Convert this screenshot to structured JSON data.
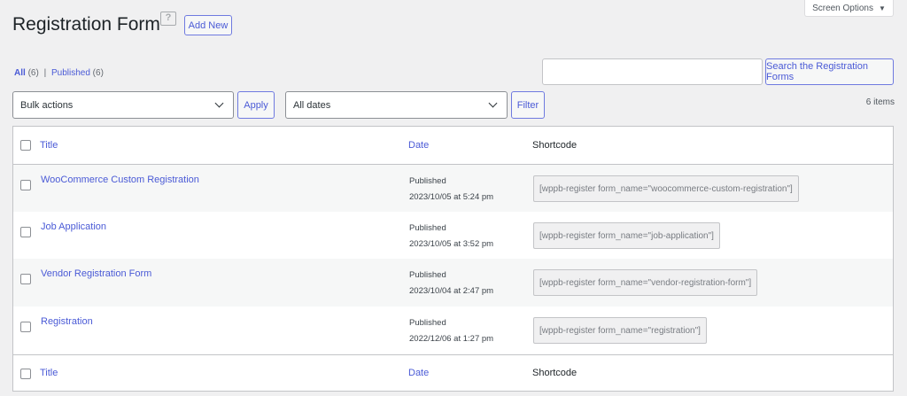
{
  "header": {
    "title": "Registration Form",
    "add_new": "Add New",
    "screen_options": "Screen Options"
  },
  "filters": {
    "all": "All",
    "all_count": "(6)",
    "sep": "|",
    "published": "Published",
    "published_count": "(6)"
  },
  "search": {
    "value": "",
    "button": "Search the Registration Forms"
  },
  "toolbar": {
    "bulk": "Bulk actions",
    "apply": "Apply",
    "dates": "All dates",
    "filter": "Filter",
    "items": "6 items"
  },
  "columns": {
    "title": "Title",
    "date": "Date",
    "shortcode": "Shortcode"
  },
  "rows": [
    {
      "title": "WooCommerce Custom Registration",
      "status": "Published",
      "date": "2023/10/05 at 5:24 pm",
      "shortcode": "[wppb-register form_name=\"woocommerce-custom-registration\"]"
    },
    {
      "title": "Job Application",
      "status": "Published",
      "date": "2023/10/05 at 3:52 pm",
      "shortcode": "[wppb-register form_name=\"job-application\"]"
    },
    {
      "title": "Vendor Registration Form",
      "status": "Published",
      "date": "2023/10/04 at 2:47 pm",
      "shortcode": "[wppb-register form_name=\"vendor-registration-form\"]"
    },
    {
      "title": "Registration",
      "status": "Published",
      "date": "2022/12/06 at 1:27 pm",
      "shortcode": "[wppb-register form_name=\"registration\"]"
    }
  ]
}
